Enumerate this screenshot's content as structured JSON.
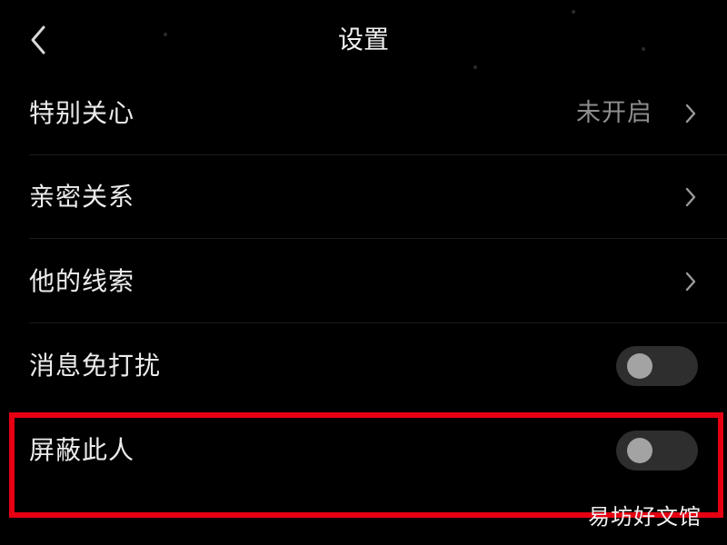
{
  "header": {
    "title": "设置",
    "back_icon": "chevron-left-icon"
  },
  "settings": [
    {
      "label": "特别关心",
      "value": "未开启",
      "control": "chevron"
    },
    {
      "label": "亲密关系",
      "control": "chevron"
    },
    {
      "label": "他的线索",
      "control": "chevron"
    },
    {
      "label": "消息免打扰",
      "control": "toggle",
      "enabled": false
    },
    {
      "label": "屏蔽此人",
      "control": "toggle",
      "enabled": false
    }
  ],
  "annotation": {
    "highlight_color": "#e60012",
    "highlighted_item": "屏蔽此人"
  },
  "watermark": "易坊好文馆",
  "colors": {
    "background": "#000000",
    "text_primary": "#ececec",
    "text_secondary": "#8e8e8e",
    "toggle_track": "#2e2e2e",
    "toggle_knob": "#a3a3a3"
  }
}
